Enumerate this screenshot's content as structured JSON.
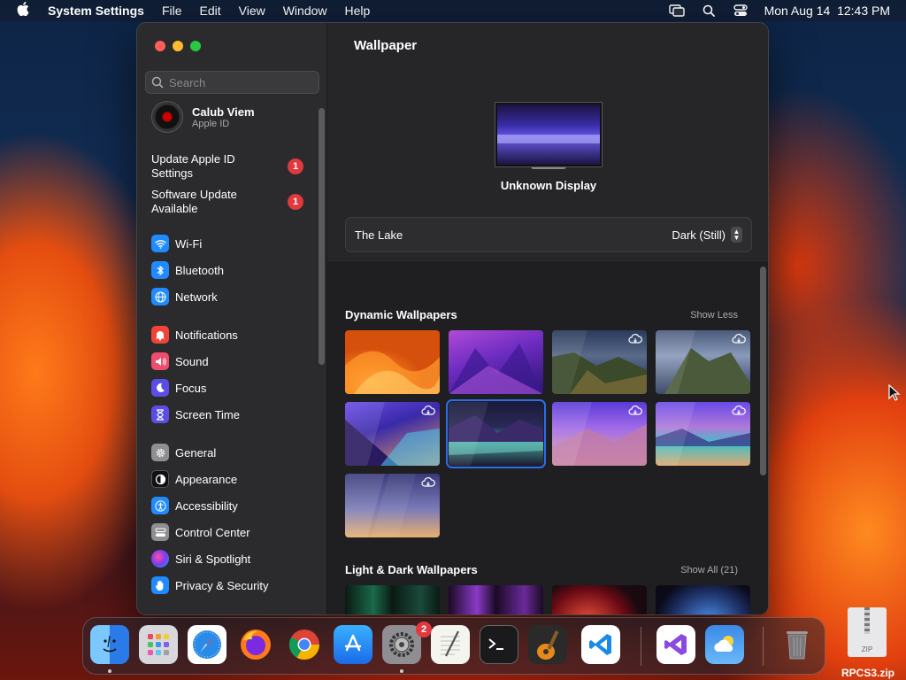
{
  "menubar": {
    "app_name": "System Settings",
    "menus": [
      "File",
      "Edit",
      "View",
      "Window",
      "Help"
    ],
    "clock": "Mon Aug 14  12:43 PM"
  },
  "sidebar": {
    "search_placeholder": "Search",
    "profile": {
      "name": "Calub Viem",
      "subtitle": "Apple ID"
    },
    "alerts": [
      {
        "label_line1": "Update Apple ID",
        "label_line2": "Settings",
        "badge": "1"
      },
      {
        "label_line1": "Software Update",
        "label_line2": "Available",
        "badge": "1"
      }
    ],
    "items": [
      {
        "label": "Wi-Fi",
        "icon": "wifi-icon",
        "color": "#1f8bff"
      },
      {
        "label": "Bluetooth",
        "icon": "bluetooth-icon",
        "color": "#1f8bff"
      },
      {
        "label": "Network",
        "icon": "globe-icon",
        "color": "#1f8bff"
      },
      {
        "label": "Notifications",
        "icon": "bell-icon",
        "color": "#f0443b"
      },
      {
        "label": "Sound",
        "icon": "speaker-icon",
        "color": "#ef4d6d"
      },
      {
        "label": "Focus",
        "icon": "moon-icon",
        "color": "#5a4ee6"
      },
      {
        "label": "Screen Time",
        "icon": "hourglass-icon",
        "color": "#5a4ee6"
      },
      {
        "label": "General",
        "icon": "gear-icon",
        "color": "#8e8e93"
      },
      {
        "label": "Appearance",
        "icon": "appearance-icon",
        "color": "#111111"
      },
      {
        "label": "Accessibility",
        "icon": "accessibility-icon",
        "color": "#1f8bff"
      },
      {
        "label": "Control Center",
        "icon": "control-center-icon",
        "color": "#8e8e93"
      },
      {
        "label": "Siri & Spotlight",
        "icon": "siri-icon",
        "color": "#b34ad6"
      },
      {
        "label": "Privacy & Security",
        "icon": "hand-icon",
        "color": "#1f8bff"
      }
    ]
  },
  "content": {
    "title": "Wallpaper",
    "display_name": "Unknown Display",
    "wallpaper_name": "The Lake",
    "appearance_value": "Dark (Still)",
    "sections": [
      {
        "title": "Dynamic Wallpapers",
        "link": "Show Less"
      },
      {
        "title": "Light & Dark Wallpapers",
        "link": "Show All (21)"
      }
    ]
  },
  "dock": {
    "settings_badge": "2",
    "file_name": "RPCS3.zip",
    "file_type": "ZIP"
  }
}
